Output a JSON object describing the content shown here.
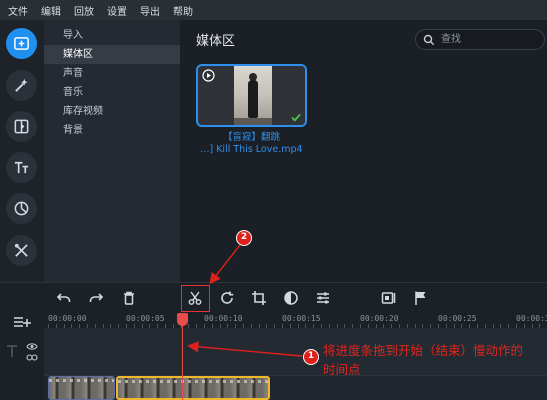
{
  "menu": [
    "文件",
    "编辑",
    "回放",
    "设置",
    "导出",
    "帮助"
  ],
  "rail": [
    {
      "icon": "import-media-icon",
      "active": true
    },
    {
      "icon": "magic-wand-icon"
    },
    {
      "icon": "transitions-icon"
    },
    {
      "icon": "titles-icon"
    },
    {
      "icon": "stickers-icon"
    },
    {
      "icon": "more-tools-icon"
    }
  ],
  "categories": [
    "导入",
    "媒体区",
    "声音",
    "音乐",
    "库存视频",
    "背景"
  ],
  "active_category": "媒体区",
  "media": {
    "title": "媒体区",
    "search_placeholder": "查找",
    "file_title": "【盲窥】翻跳",
    "file_name": "...] Kill This Love.mp4"
  },
  "toolbar": [
    "undo-icon",
    "redo-icon",
    "delete-icon",
    "cut-icon",
    "rotate-icon",
    "crop-icon",
    "color-adjust-icon",
    "properties-icon",
    "fit-screen-icon",
    "marker-flag-icon"
  ],
  "timeline": {
    "ticks": [
      "00:00:00",
      "00:00:05",
      "00:00:10",
      "00:00:15",
      "00:00:20",
      "00:00:25",
      "00:00:3"
    ]
  },
  "annotation": {
    "badge1": "1",
    "badge2": "2",
    "text": "将进度条拖到开始（结束）慢动作的时间点"
  },
  "colors": {
    "accent": "#1f8ff0",
    "annotation": "#e0201b",
    "playhead": "#e94d4a",
    "clip_selected": "#f0b72d"
  }
}
